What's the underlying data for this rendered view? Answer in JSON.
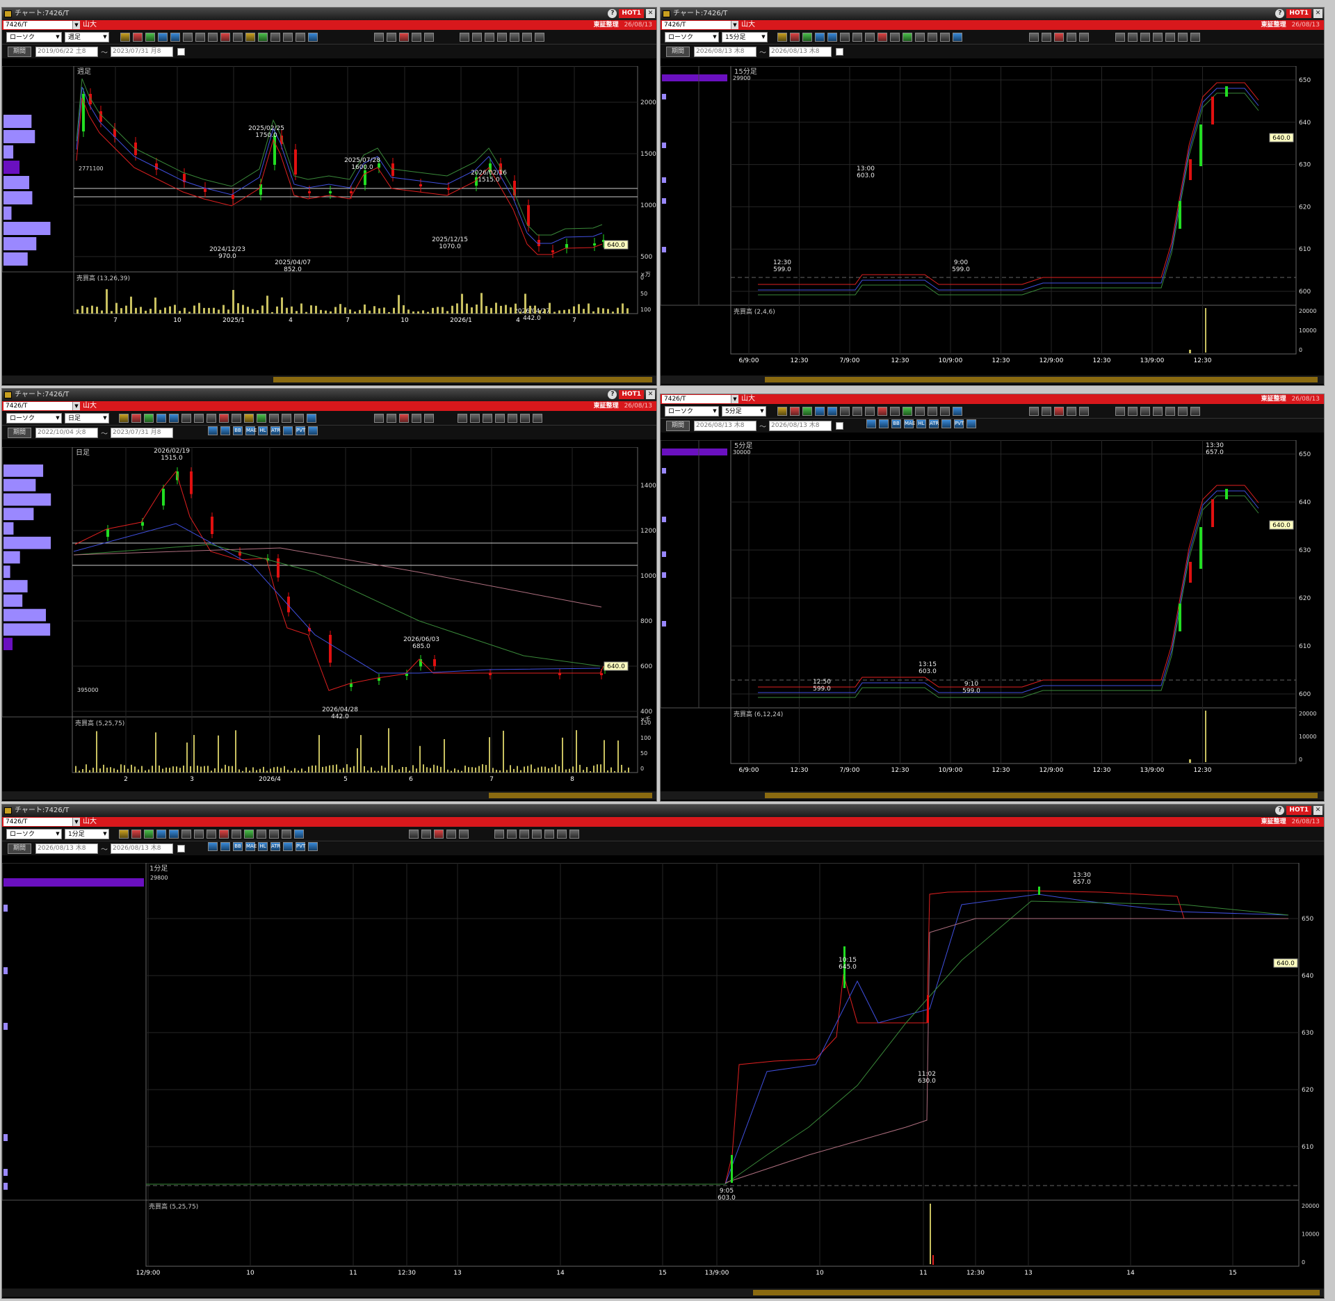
{
  "windows": [
    {
      "id": "w1",
      "title": "チャート:7426/T",
      "hot": "HOT1",
      "symbol": "7426/T",
      "company": "山大",
      "exchange": "東証整理",
      "date": "26/08/13",
      "chart_type": "ローソク",
      "period_type": "週足",
      "period_label": "期間",
      "date_from": "2019/06/22 土8",
      "date_to": "2023/07/31 月8",
      "chart_label": "週足",
      "volume_label": "売買高 (13,26,39)",
      "volume_unit": "×万",
      "vol_ticks": [
        "0",
        "50",
        "100"
      ],
      "price_tag": "640.0",
      "vol_marker": "2771100",
      "y_ticks": [
        "2000",
        "1500",
        "1000",
        "500"
      ],
      "x_ticks": [
        "7",
        "10",
        "2025/1",
        "4",
        "7",
        "10",
        "2026/1",
        "4",
        "7"
      ],
      "annotations": [
        {
          "date": "2025/02/25",
          "value": "1750.0"
        },
        {
          "date": "2025/07/28",
          "value": "1600.0"
        },
        {
          "date": "2026/02/16",
          "value": "1515.0"
        },
        {
          "date": "2024/12/23",
          "value": "970.0"
        },
        {
          "date": "2025/04/07",
          "value": "852.0"
        },
        {
          "date": "2025/12/15",
          "value": "1070.0"
        },
        {
          "date": "2026/04/27",
          "value": "442.0"
        }
      ]
    },
    {
      "id": "w2",
      "title": "チャート:7426/T",
      "hot": "HOT1",
      "symbol": "7426/T",
      "company": "山大",
      "exchange": "東証整理",
      "date": "26/08/13",
      "chart_type": "ローソク",
      "period_type": "15分足",
      "period_label": "期間",
      "date_from": "2026/08/13 木8",
      "date_to": "2026/08/13 木8",
      "chart_label": "15分足",
      "vol_marker": "29900",
      "volume_label": "売買高 (2,4,6)",
      "vol_ticks": [
        "20000",
        "10000",
        "0"
      ],
      "price_tag": "640.0",
      "y_ticks": [
        "650",
        "640",
        "630",
        "620",
        "610",
        "600"
      ],
      "x_ticks": [
        "6/9:00",
        "12:30",
        "7/9:00",
        "12:30",
        "10/9:00",
        "12:30",
        "12/9:00",
        "12:30",
        "13/9:00",
        "12:30"
      ],
      "annotations": [
        {
          "date": "13:00",
          "value": "603.0"
        },
        {
          "date": "12:30",
          "value": "599.0"
        },
        {
          "date": "9:00",
          "value": "599.0"
        }
      ]
    },
    {
      "id": "w3",
      "title": "チャート:7426/T",
      "hot": "HOT1",
      "symbol": "7426/T",
      "company": "山大",
      "exchange": "東証整理",
      "date": "26/08/13",
      "chart_type": "ローソク",
      "period_type": "日足",
      "period_label": "期間",
      "date_from": "2022/10/04 火8",
      "date_to": "2023/07/31 月8",
      "chart_label": "日足",
      "volume_label": "売買高 (5,25,75)",
      "volume_unit": "×千",
      "vol_ticks": [
        "150",
        "100",
        "50",
        "0"
      ],
      "price_tag": "640.0",
      "vol_marker": "395000",
      "y_ticks": [
        "1400",
        "1200",
        "1000",
        "800",
        "600",
        "400"
      ],
      "x_ticks": [
        "2",
        "3",
        "2026/4",
        "5",
        "6",
        "7",
        "8"
      ],
      "annotations": [
        {
          "date": "2026/02/19",
          "value": "1515.0"
        },
        {
          "date": "2026/06/03",
          "value": "685.0"
        },
        {
          "date": "2026/04/28",
          "value": "442.0"
        }
      ]
    },
    {
      "id": "w4",
      "title": "",
      "symbol": "7426/T",
      "company": "山大",
      "exchange": "東証整理",
      "date": "26/08/13",
      "chart_type": "ローソク",
      "period_type": "5分足",
      "period_label": "期間",
      "date_from": "2026/08/13 木8",
      "date_to": "2026/08/13 木8",
      "chart_label": "5分足",
      "vol_marker": "30000",
      "volume_label": "売買高 (6,12,24)",
      "vol_ticks": [
        "20000",
        "10000",
        "0"
      ],
      "price_tag": "640.0",
      "y_ticks": [
        "650",
        "640",
        "630",
        "620",
        "610",
        "600"
      ],
      "x_ticks": [
        "6/9:00",
        "12:30",
        "7/9:00",
        "12:30",
        "10/9:00",
        "12:30",
        "12/9:00",
        "12:30",
        "13/9:00",
        "12:30"
      ],
      "annotations": [
        {
          "date": "13:30",
          "value": "657.0"
        },
        {
          "date": "13:15",
          "value": "603.0"
        },
        {
          "date": "12:50",
          "value": "599.0"
        },
        {
          "date": "9:10",
          "value": "599.0"
        }
      ]
    },
    {
      "id": "w5",
      "title": "チャート:7426/T",
      "hot": "HOT1",
      "symbol": "7426/T",
      "company": "山大",
      "exchange": "東証整理",
      "date": "26/08/13",
      "chart_type": "ローソク",
      "period_type": "1分足",
      "period_label": "期間",
      "date_from": "2026/08/13 木8",
      "date_to": "2026/08/13 木8",
      "chart_label": "1分足",
      "vol_marker": "29800",
      "volume_label": "売買高 (5,25,75)",
      "vol_ticks": [
        "20000",
        "10000",
        "0"
      ],
      "price_tag": "640.0",
      "y_ticks": [
        "650",
        "640",
        "630",
        "620",
        "610"
      ],
      "x_ticks": [
        "12/9:00",
        "10",
        "11",
        "12:30",
        "13",
        "14",
        "15",
        "13/9:00",
        "10",
        "11",
        "12:30",
        "13",
        "14",
        "15"
      ],
      "annotations": [
        {
          "date": "13:30",
          "value": "657.0"
        },
        {
          "date": "10:15",
          "value": "645.0"
        },
        {
          "date": "11:02",
          "value": "630.0"
        },
        {
          "date": "9:05",
          "value": "603.0"
        }
      ]
    }
  ],
  "indicator_buttons": [
    "BB",
    "MAE",
    "HL",
    "ATR",
    "PVT"
  ],
  "colors": {
    "up": "#22dd22",
    "down": "#e01010",
    "ma_short": "#e02020",
    "ma_mid": "#4050e0",
    "ma_long": "#3a8a3a",
    "ma_xlong": "#b07080",
    "volume": "#c8c060",
    "tag": "#ffffc0",
    "profile": "#9a88ff",
    "profile_dark": "#6a10c0"
  }
}
